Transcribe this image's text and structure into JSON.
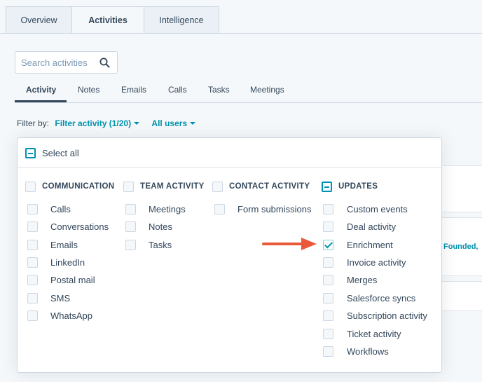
{
  "top_tabs": [
    {
      "label": "Overview"
    },
    {
      "label": "Activities",
      "active": true
    },
    {
      "label": "Intelligence"
    }
  ],
  "search": {
    "placeholder": "Search activities",
    "icon": "search-icon"
  },
  "sub_tabs": [
    {
      "label": "Activity",
      "active": true
    },
    {
      "label": "Notes"
    },
    {
      "label": "Emails"
    },
    {
      "label": "Calls"
    },
    {
      "label": "Tasks"
    },
    {
      "label": "Meetings"
    }
  ],
  "filter": {
    "label": "Filter by:",
    "activity_link": "Filter activity (1/20)",
    "users_link": "All users"
  },
  "background": {
    "peek_text": "Founded,"
  },
  "dropdown": {
    "select_all": {
      "label": "Select all",
      "state": "indeterminate"
    },
    "groups": [
      {
        "header": "COMMUNICATION",
        "state": "unchecked",
        "items": [
          {
            "label": "Calls",
            "checked": false
          },
          {
            "label": "Conversations",
            "checked": false
          },
          {
            "label": "Emails",
            "checked": false
          },
          {
            "label": "LinkedIn",
            "checked": false
          },
          {
            "label": "Postal mail",
            "checked": false
          },
          {
            "label": "SMS",
            "checked": false
          },
          {
            "label": "WhatsApp",
            "checked": false
          }
        ]
      },
      {
        "header": "TEAM ACTIVITY",
        "state": "unchecked",
        "items": [
          {
            "label": "Meetings",
            "checked": false
          },
          {
            "label": "Notes",
            "checked": false
          },
          {
            "label": "Tasks",
            "checked": false
          }
        ]
      },
      {
        "header": "CONTACT ACTIVITY",
        "state": "unchecked",
        "items": [
          {
            "label": "Form submissions",
            "checked": false
          }
        ]
      },
      {
        "header": "UPDATES",
        "state": "indeterminate",
        "items": [
          {
            "label": "Custom events",
            "checked": false
          },
          {
            "label": "Deal activity",
            "checked": false
          },
          {
            "label": "Enrichment",
            "checked": true
          },
          {
            "label": "Invoice activity",
            "checked": false
          },
          {
            "label": "Merges",
            "checked": false
          },
          {
            "label": "Salesforce syncs",
            "checked": false
          },
          {
            "label": "Subscription activity",
            "checked": false
          },
          {
            "label": "Ticket activity",
            "checked": false
          },
          {
            "label": "Workflows",
            "checked": false
          }
        ]
      }
    ]
  },
  "colors": {
    "accent": "#0091ae",
    "text": "#33475b",
    "arrow": "#ea5a3a",
    "border": "#cbd6e2"
  }
}
